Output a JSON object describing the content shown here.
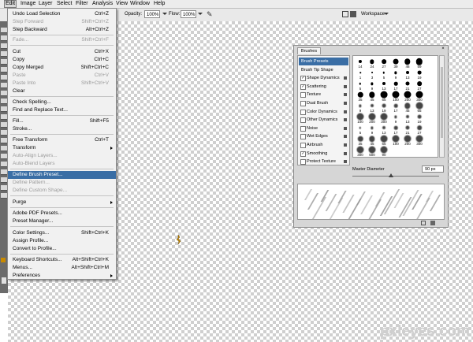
{
  "menubar": {
    "items": [
      "Edit",
      "Image",
      "Layer",
      "Select",
      "Filter",
      "Analysis",
      "View",
      "Window",
      "Help"
    ]
  },
  "options_bar": {
    "opacity_label": "Opacity:",
    "opacity_value": "100%",
    "flow_label": "Flow:",
    "flow_value": "100%",
    "workspace_label": "Workspace"
  },
  "edit_menu": {
    "items": [
      {
        "label": "Undo Load Selection",
        "shortcut": "Ctrl+Z",
        "disabled": false
      },
      {
        "label": "Step Forward",
        "shortcut": "Shift+Ctrl+Z",
        "disabled": true
      },
      {
        "label": "Step Backward",
        "shortcut": "Alt+Ctrl+Z",
        "disabled": false
      },
      {
        "label": "Fade...",
        "shortcut": "Shift+Ctrl+F",
        "disabled": true
      },
      {
        "label": "Cut",
        "shortcut": "Ctrl+X",
        "disabled": false
      },
      {
        "label": "Copy",
        "shortcut": "Ctrl+C",
        "disabled": false
      },
      {
        "label": "Copy Merged",
        "shortcut": "Shift+Ctrl+C",
        "disabled": false
      },
      {
        "label": "Paste",
        "shortcut": "Ctrl+V",
        "disabled": true
      },
      {
        "label": "Paste Into",
        "shortcut": "Shift+Ctrl+V",
        "disabled": true
      },
      {
        "label": "Clear",
        "shortcut": "",
        "disabled": false
      },
      {
        "label": "Check Spelling...",
        "shortcut": "",
        "disabled": false
      },
      {
        "label": "Find and Replace Text...",
        "shortcut": "",
        "disabled": false
      },
      {
        "label": "Fill...",
        "shortcut": "Shift+F5",
        "disabled": false
      },
      {
        "label": "Stroke...",
        "shortcut": "",
        "disabled": false
      },
      {
        "label": "Free Transform",
        "shortcut": "Ctrl+T",
        "disabled": false
      },
      {
        "label": "Transform",
        "shortcut": "",
        "disabled": false
      },
      {
        "label": "Auto-Align Layers...",
        "shortcut": "",
        "disabled": true
      },
      {
        "label": "Auto-Blend Layers",
        "shortcut": "",
        "disabled": true
      },
      {
        "label": "Define Brush Preset...",
        "shortcut": "",
        "disabled": false
      },
      {
        "label": "Define Pattern...",
        "shortcut": "",
        "disabled": true
      },
      {
        "label": "Define Custom Shape...",
        "shortcut": "",
        "disabled": true
      },
      {
        "label": "Purge",
        "shortcut": "",
        "disabled": false
      },
      {
        "label": "Adobe PDF Presets...",
        "shortcut": "",
        "disabled": false
      },
      {
        "label": "Preset Manager...",
        "shortcut": "",
        "disabled": false
      },
      {
        "label": "Color Settings...",
        "shortcut": "Shift+Ctrl+K",
        "disabled": false
      },
      {
        "label": "Assign Profile...",
        "shortcut": "",
        "disabled": false
      },
      {
        "label": "Convert to Profile...",
        "shortcut": "",
        "disabled": false
      },
      {
        "label": "Keyboard Shortcuts...",
        "shortcut": "Alt+Shift+Ctrl+K",
        "disabled": false
      },
      {
        "label": "Menus...",
        "shortcut": "Alt+Shift+Ctrl+M",
        "disabled": false
      },
      {
        "label": "Preferences",
        "shortcut": "",
        "disabled": false
      }
    ]
  },
  "brushes_panel": {
    "tab_label": "Brushes",
    "close_glyph": "×",
    "list": [
      {
        "label": "Brush Presets",
        "checked": false,
        "selected": true,
        "checkbox": false
      },
      {
        "label": "Brush Tip Shape",
        "checked": false,
        "selected": false,
        "checkbox": false
      },
      {
        "label": "Shape Dynamics",
        "checked": true,
        "selected": false,
        "checkbox": true
      },
      {
        "label": "Scattering",
        "checked": true,
        "selected": false,
        "checkbox": true
      },
      {
        "label": "Texture",
        "checked": false,
        "selected": false,
        "checkbox": true
      },
      {
        "label": "Dual Brush",
        "checked": false,
        "selected": false,
        "checkbox": true
      },
      {
        "label": "Color Dynamics",
        "checked": false,
        "selected": false,
        "checkbox": true
      },
      {
        "label": "Other Dynamics",
        "checked": false,
        "selected": false,
        "checkbox": true
      },
      {
        "label": "Noise",
        "checked": false,
        "selected": false,
        "checkbox": true
      },
      {
        "label": "Wet Edges",
        "checked": false,
        "selected": false,
        "checkbox": true
      },
      {
        "label": "Airbrush",
        "checked": false,
        "selected": false,
        "checkbox": true
      },
      {
        "label": "Smoothing",
        "checked": true,
        "selected": false,
        "checkbox": true
      },
      {
        "label": "Protect Texture",
        "checked": false,
        "selected": false,
        "checkbox": true
      }
    ],
    "preset_sizes": [
      [
        "14",
        "24",
        "27",
        "39",
        "46",
        "59",
        "",
        ""
      ],
      [
        "1",
        "3",
        "5",
        "9",
        "13",
        "19",
        ""
      ],
      [
        "5",
        "9",
        "13",
        "17",
        "21",
        "27",
        ""
      ],
      [
        "35",
        "45",
        "65",
        "100",
        "200",
        "300",
        ""
      ],
      [
        "9",
        "13",
        "19",
        "17",
        "45",
        "65",
        ""
      ],
      [
        "100",
        "200",
        "300",
        "9",
        "13",
        "19",
        ""
      ],
      [
        "5",
        "9",
        "13",
        "17",
        "21",
        "27",
        ""
      ],
      [
        "35",
        "45",
        "65",
        "100",
        "200",
        "300",
        ""
      ],
      [
        "300",
        "500",
        "90",
        "",
        "",
        "",
        ""
      ]
    ],
    "master_diameter_label": "Master Diameter",
    "master_diameter_value": "90 px"
  },
  "watermark": "pxleyes.com"
}
